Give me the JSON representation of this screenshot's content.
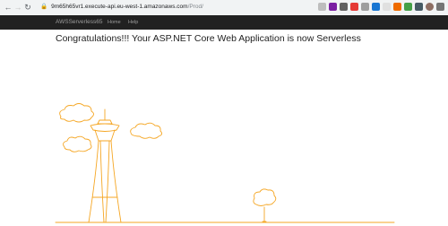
{
  "browser": {
    "url_host": "9m65h65vr1.execute-api.eu-west-1.amazonaws.com",
    "url_path": "/Prod/"
  },
  "navbar": {
    "brand": "AWSServerless65",
    "links": [
      {
        "label": "Home"
      },
      {
        "label": "Help"
      }
    ]
  },
  "main": {
    "heading": "Congratulations!!! Your ASP.NET Core Web Application is now Serverless"
  },
  "colors": {
    "navbar_bg": "#212121",
    "illustration_stroke": "#f5a623"
  }
}
